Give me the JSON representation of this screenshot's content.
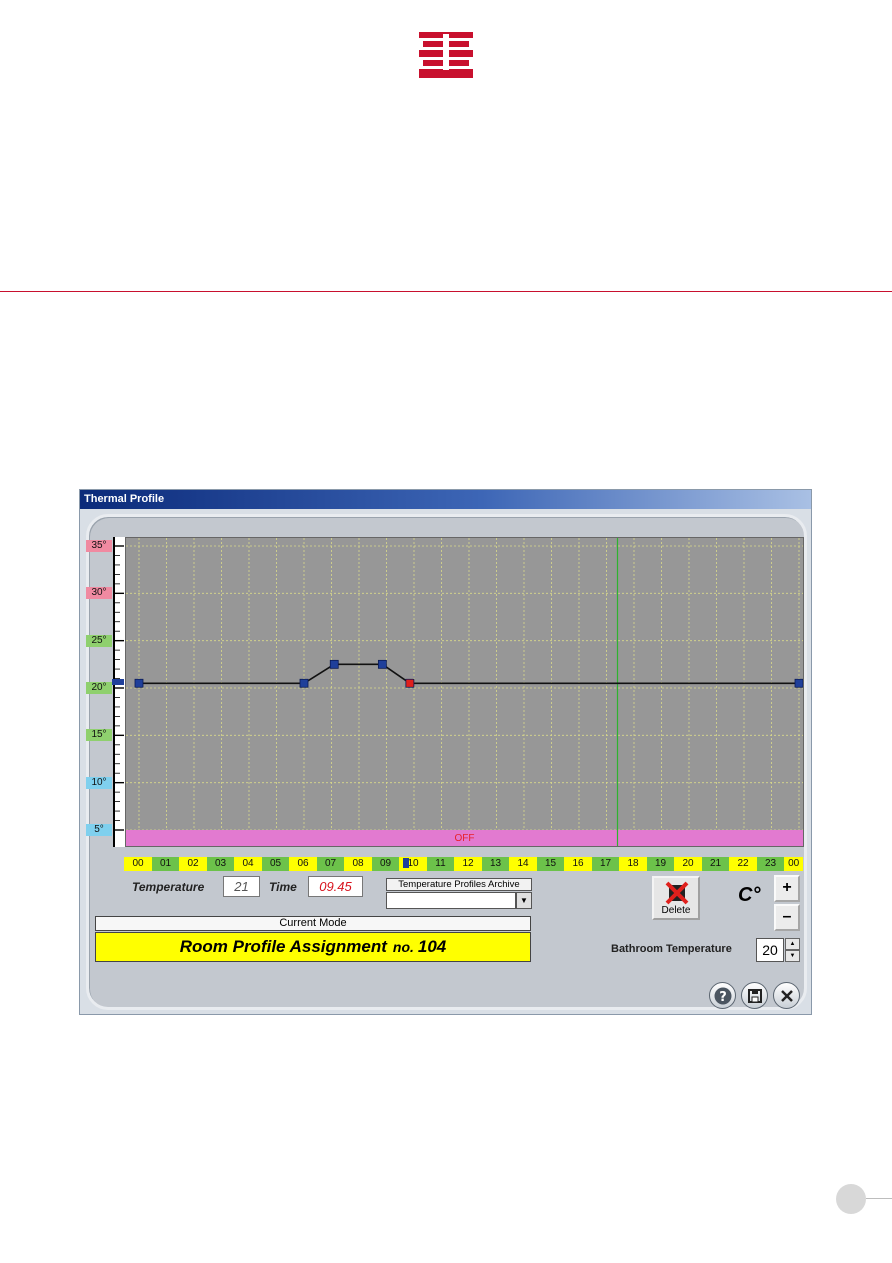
{
  "window": {
    "title": "Thermal Profile"
  },
  "chart_data": {
    "type": "line",
    "y_ticks": [
      "35°",
      "30°",
      "25°",
      "20°",
      "15°",
      "10°",
      "5°"
    ],
    "y_tick_colors": [
      "#f08aa1",
      "#f08aa1",
      "#8fd06e",
      "#8fd06e",
      "#8fd06e",
      "#7fd0ee",
      "#7fd0ee"
    ],
    "x_ticks": [
      "00",
      "01",
      "02",
      "03",
      "04",
      "05",
      "06",
      "07",
      "08",
      "09",
      "10",
      "11",
      "12",
      "13",
      "14",
      "15",
      "16",
      "17",
      "18",
      "19",
      "20",
      "21",
      "22",
      "23",
      "00"
    ],
    "x_tick_colors": [
      "#ffff00",
      "#6cc24a",
      "#ffff00",
      "#6cc24a",
      "#ffff00",
      "#6cc24a",
      "#ffff00",
      "#6cc24a",
      "#ffff00",
      "#6cc24a",
      "#ffff00",
      "#6cc24a",
      "#ffff00",
      "#6cc24a",
      "#ffff00",
      "#6cc24a",
      "#ffff00",
      "#6cc24a",
      "#ffff00",
      "#6cc24a",
      "#ffff00",
      "#6cc24a",
      "#ffff00",
      "#6cc24a",
      "#ffff00"
    ],
    "ylim": [
      5,
      35
    ],
    "xlim": [
      0,
      24
    ],
    "off_label": "OFF",
    "current_time_hour": 17.4,
    "points": [
      {
        "x": 0.0,
        "y": 20.5
      },
      {
        "x": 6.0,
        "y": 20.5
      },
      {
        "x": 7.1,
        "y": 22.5
      },
      {
        "x": 8.85,
        "y": 22.5
      },
      {
        "x": 9.85,
        "y": 20.5
      },
      {
        "x": 24.0,
        "y": 20.5
      }
    ],
    "selected_point_index": 4,
    "grid": true
  },
  "controls": {
    "temperature_label": "Temperature",
    "temperature_value": "21",
    "time_label": "Time",
    "time_value": "09.45",
    "archive_label": "Temperature Profiles Archive",
    "archive_value": "",
    "current_mode_label": "Current Mode",
    "mode_text": "Room Profile Assignment",
    "mode_no_label": "no.",
    "mode_number": "104",
    "delete_label": "Delete",
    "unit_label": "C°",
    "plus_label": "+",
    "minus_label": "–",
    "bath_label": "Bathroom Temperature",
    "bath_value": "20"
  },
  "colors": {
    "brand_red": "#c8102e",
    "mode_yellow": "#ffff00",
    "off_band": "#e27ad0"
  }
}
